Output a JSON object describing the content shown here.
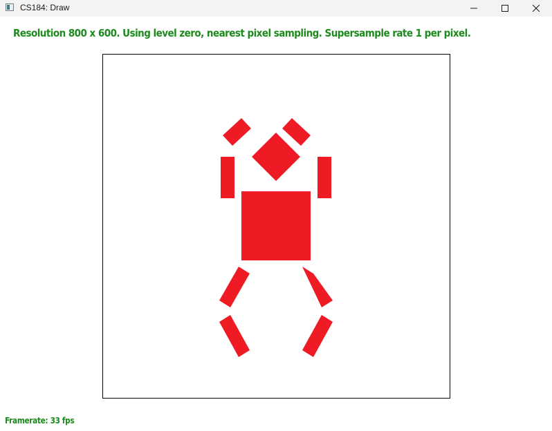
{
  "window": {
    "title": "CS184: Draw"
  },
  "overlay": {
    "status": "Resolution 800 x 600. Using level zero, nearest pixel sampling. Supersample rate 1 per pixel.",
    "framerate": "Framerate: 33 fps"
  },
  "colors": {
    "figure_fill": "#ee1b24",
    "overlay_text": "#1e8a1e"
  },
  "icons": {
    "app": "app-icon",
    "minimize": "minimize-icon",
    "maximize": "maximize-icon",
    "close": "close-icon"
  }
}
